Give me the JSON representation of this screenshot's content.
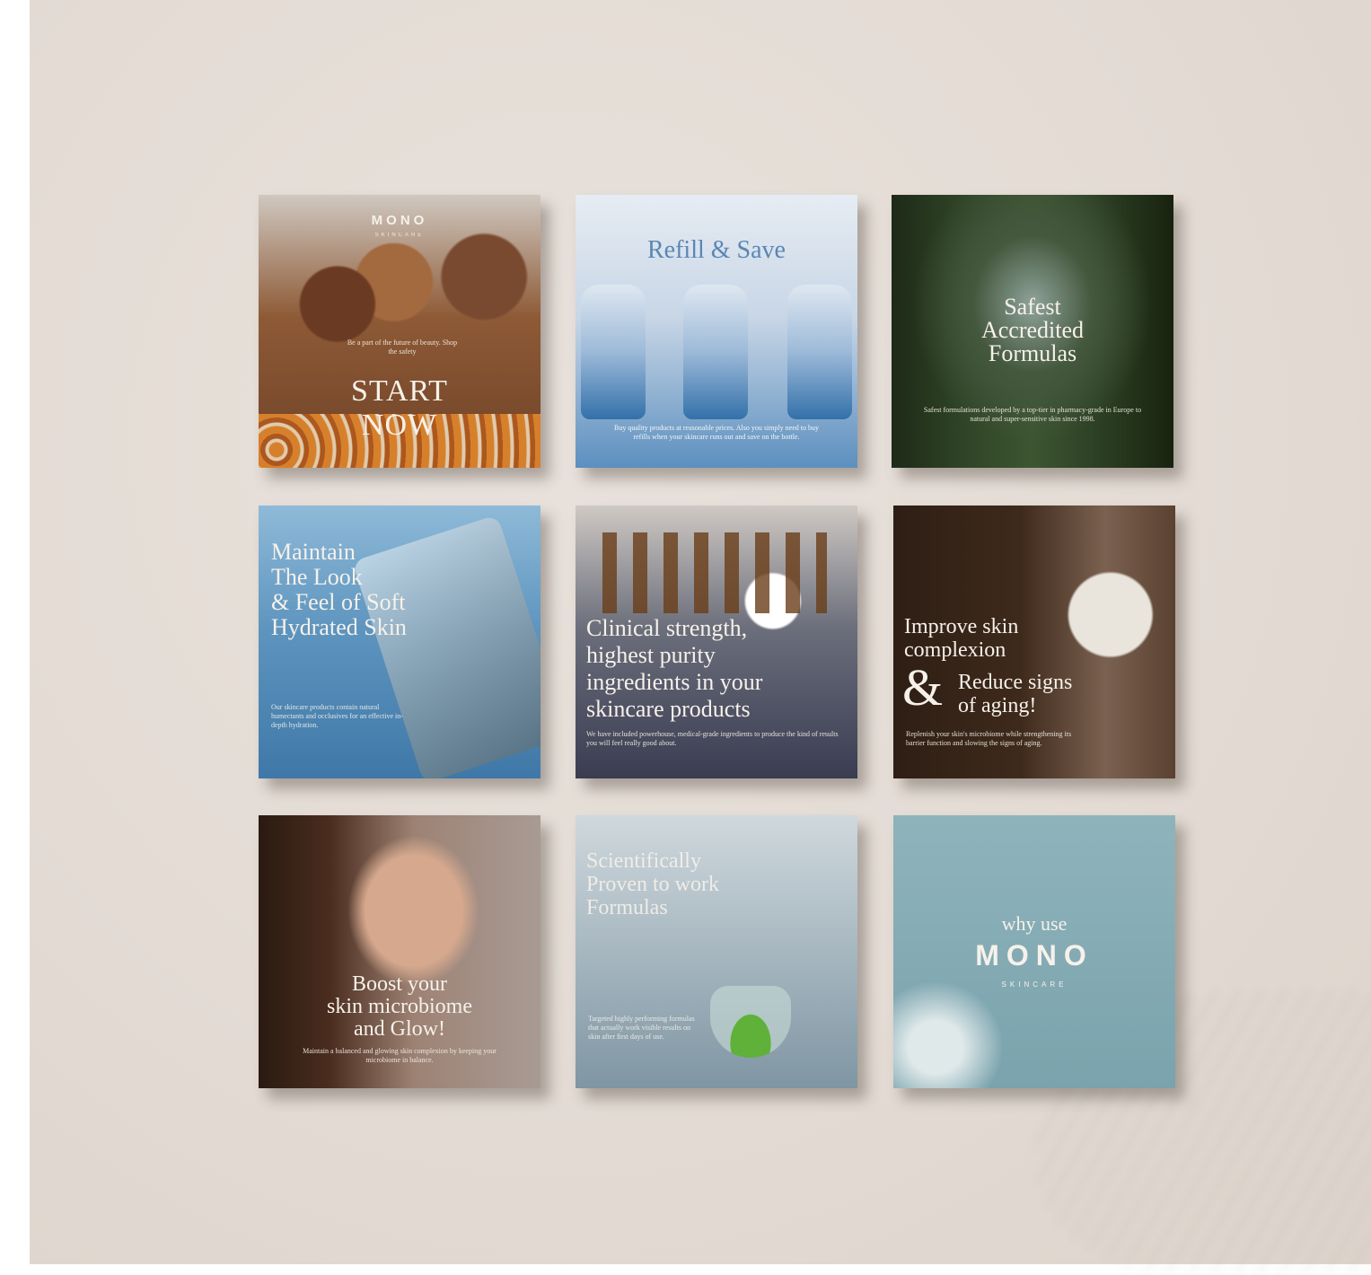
{
  "tiles": [
    {
      "logo": "MONO",
      "logo_sub": "SKINCARE",
      "lead": "Be a part of the future of beauty. Shop the safety",
      "title_line1": "START",
      "title_line2": "NOW"
    },
    {
      "title": "Refill & Save",
      "sub": "Buy quality products at reasonable prices. Also you simply need to buy refills when your skincare runs out and save on the bottle."
    },
    {
      "title_line1": "Safest",
      "title_line2": "Accredited",
      "title_line3": "Formulas",
      "sub": "Safest formulations developed by a top-tier in pharmacy-grade in Europe to natural and super-sensitive skin since 1998."
    },
    {
      "title_line1": "Maintain",
      "title_line2": "The Look",
      "title_line3": "& Feel of Soft",
      "title_line4": "Hydrated Skin",
      "sub": "Our skincare products contain natural humectants and occlusives for an effective in-depth hydration."
    },
    {
      "title_line1": "Clinical strength,",
      "title_line2": "highest purity",
      "title_line3": "ingredients in your",
      "title_line4": "skincare products",
      "sub": "We have included powerhouse, medical-grade ingredients to produce the kind of results you will feel really good about."
    },
    {
      "title_line1": "Improve skin",
      "title_line2": "complexion",
      "amp": "&",
      "title_line3": "Reduce signs",
      "title_line4": "of aging!",
      "sub": "Replenish your skin's microbiome while strengthening its barrier function and slowing the signs of aging."
    },
    {
      "title_line1": "Boost your",
      "title_line2": "skin microbiome",
      "title_line3": "and Glow!",
      "sub": "Maintain a balanced and glowing skin complexion by keeping your microbiome in balance."
    },
    {
      "title_line1": "Scientifically",
      "title_line2": "Proven to work",
      "title_line3": "Formulas",
      "sub": "Targeted highly performing formulas that actually work visible results on skin after first days of use."
    },
    {
      "pre": "why use",
      "logo": "MONO",
      "logo_sub": "SKINCARE"
    }
  ]
}
